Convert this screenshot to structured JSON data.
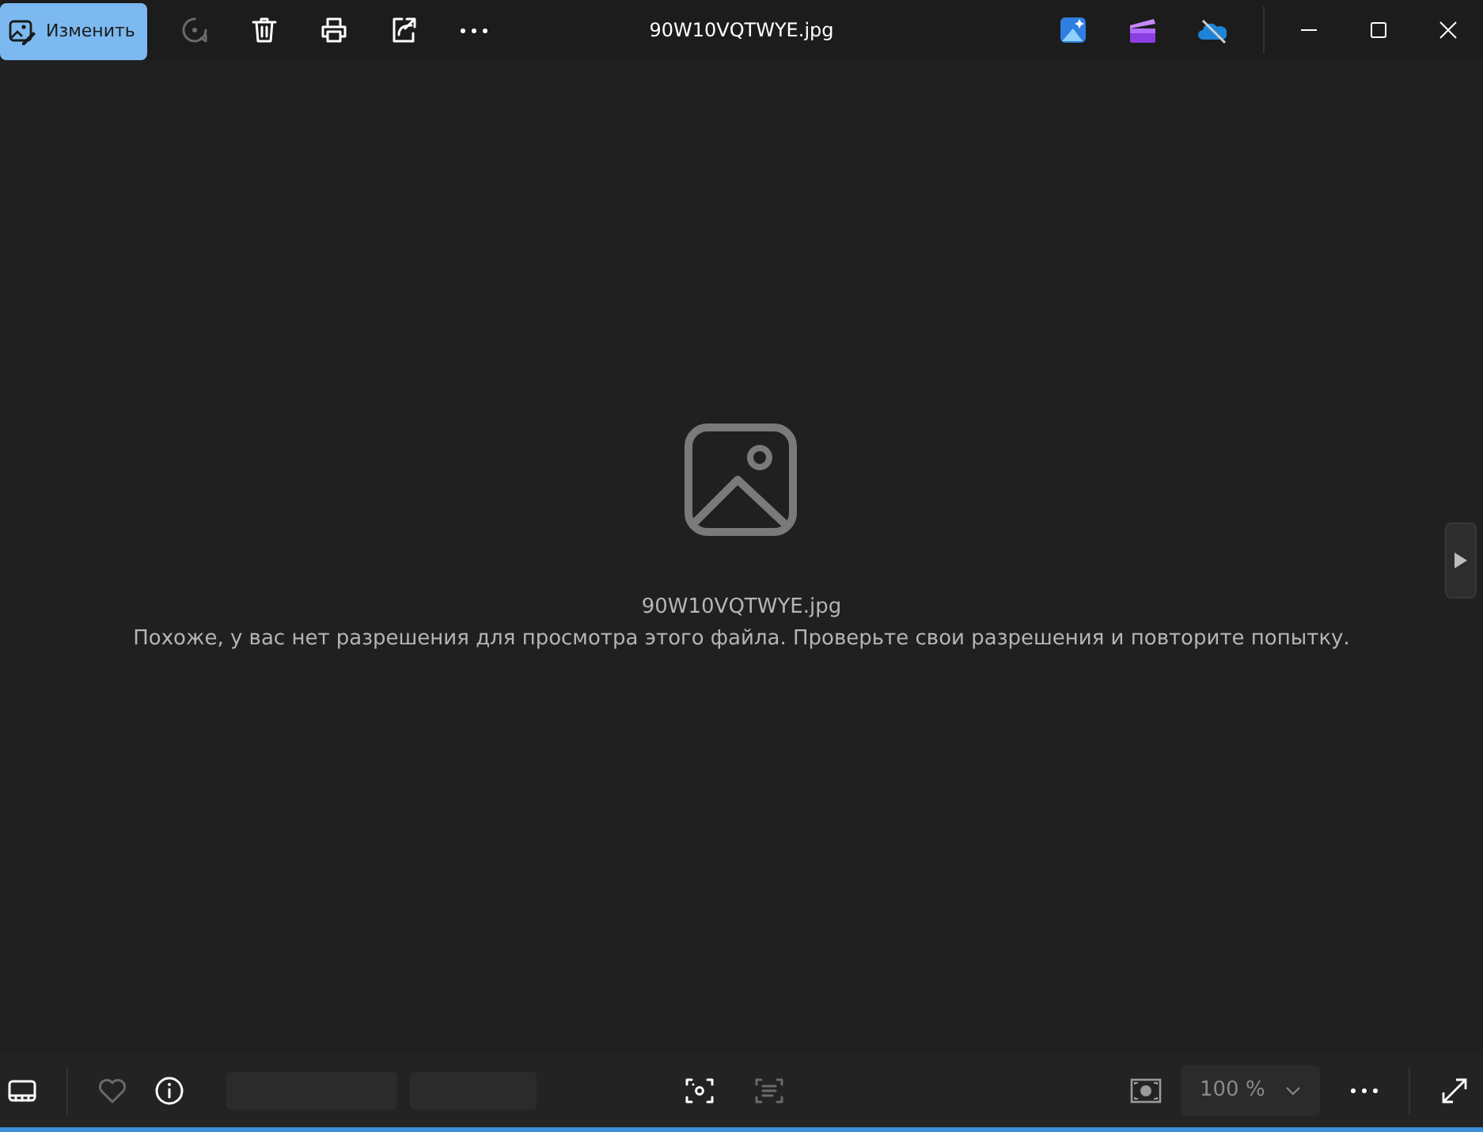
{
  "window": {
    "title": "90W10VQTWYE.jpg"
  },
  "toolbar": {
    "edit_button": {
      "label": "Изменить"
    },
    "actions": [
      {
        "kind": "rotate",
        "disabled": true
      },
      {
        "kind": "delete",
        "disabled": false
      },
      {
        "kind": "print",
        "disabled": false
      },
      {
        "kind": "share",
        "disabled": false
      },
      {
        "kind": "more",
        "disabled": false
      }
    ],
    "apps": [
      {
        "kind": "designer"
      },
      {
        "kind": "clipchamp"
      },
      {
        "kind": "onedrive"
      }
    ]
  },
  "viewer": {
    "file_name": "90W10VQTWYE.jpg",
    "message": "Похоже, у вас нет разрешения для просмотра этого файла. Проверьте свои разрешения и повторите попытку."
  },
  "bottom_bar": {
    "left": [
      {
        "kind": "filmstrip",
        "disabled": false
      },
      {
        "kind": "favorite",
        "disabled": true
      },
      {
        "kind": "info",
        "disabled": false
      }
    ],
    "center": [
      {
        "kind": "visual-search",
        "disabled": false
      },
      {
        "kind": "text-scan",
        "disabled": true
      }
    ],
    "zoom": {
      "value": "100 %"
    }
  }
}
